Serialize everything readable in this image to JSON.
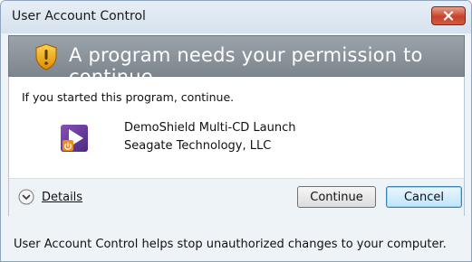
{
  "window": {
    "title": "User Account Control",
    "close_icon": "close-icon"
  },
  "banner": {
    "icon": "shield-warning-icon",
    "message": "A program needs your permission to continue"
  },
  "content": {
    "intro": "If you started this program, continue.",
    "program": {
      "icon": "app-icon",
      "name": "DemoShield Multi-CD Launch",
      "publisher": "Seagate Technology, LLC"
    }
  },
  "actions": {
    "details_label": "Details",
    "details_icon": "chevron-down-icon",
    "continue_label": "Continue",
    "cancel_label": "Cancel"
  },
  "footer": {
    "text": "User Account Control helps stop unauthorized changes to your computer."
  },
  "colors": {
    "banner": "#868f96",
    "close_button": "#c7422a",
    "cancel_focus": "#3c7fb1"
  }
}
